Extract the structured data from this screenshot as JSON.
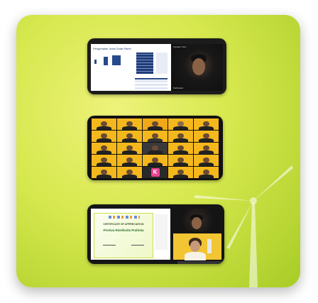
{
  "card": {
    "background_colors": [
      "#eef27a",
      "#d6e84e",
      "#a8cc26"
    ]
  },
  "shot1": {
    "slide_title": "Pengenalan Jenis Solar Panel",
    "camera_top_label": "Speaker View",
    "camera_label": "Participant"
  },
  "shot2": {
    "tile_color": "#f5b81c",
    "k_badge": "K"
  },
  "shot3": {
    "cert_title": "CERTIFICATE OF APPRECIATION",
    "cert_name": "Pristiva Rizellovila Prahista"
  }
}
